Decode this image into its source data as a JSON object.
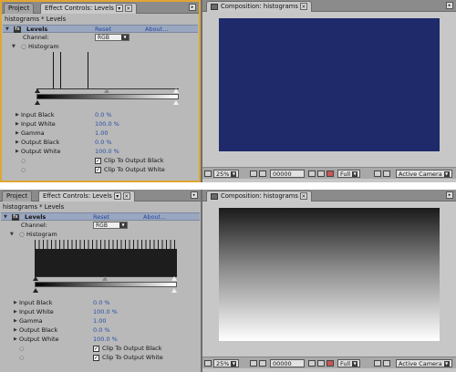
{
  "screens": [
    {
      "tabs": {
        "project": "Project",
        "effect_controls": "Effect Controls: Levels",
        "composition": "Composition: histograms"
      },
      "breadcrumb": "histograms * Levels",
      "effect": {
        "name": "Levels",
        "reset": "Reset",
        "about": "About...",
        "channel_label": "Channel:",
        "channel_value": "RGB",
        "histogram_label": "Histogram"
      },
      "properties": [
        {
          "label": "Input Black",
          "value": "0.0 %"
        },
        {
          "label": "Input White",
          "value": "100.0 %"
        },
        {
          "label": "Gamma",
          "value": "1.00"
        },
        {
          "label": "Output Black",
          "value": "0.0 %"
        },
        {
          "label": "Output White",
          "value": "100.0 %"
        }
      ],
      "checkboxes": [
        "Clip To Output Black",
        "Clip To Output White"
      ],
      "viewer_fill": "#1e2a6a",
      "toolbar": {
        "zoom": "25%",
        "timecode": "00000",
        "resolution": "Full",
        "camera": "Active Camera"
      }
    },
    {
      "tabs": {
        "project": "Project",
        "effect_controls": "Effect Controls: Levels",
        "composition": "Composition: histograms"
      },
      "breadcrumb": "histograms * Levels",
      "effect": {
        "name": "Levels",
        "reset": "Reset",
        "about": "About...",
        "channel_label": "Channel:",
        "channel_value": "RGB",
        "histogram_label": "Histogram"
      },
      "properties": [
        {
          "label": "Input Black",
          "value": "0.0 %"
        },
        {
          "label": "Input White",
          "value": "100.0 %"
        },
        {
          "label": "Gamma",
          "value": "1.00"
        },
        {
          "label": "Output Black",
          "value": "0.0 %"
        },
        {
          "label": "Output White",
          "value": "100.0 %"
        }
      ],
      "checkboxes": [
        "Clip To Output Black",
        "Clip To Output White"
      ],
      "viewer_fill": "gradient",
      "toolbar": {
        "zoom": "25%",
        "timecode": "00000",
        "resolution": "Full",
        "camera": "Active Camera"
      }
    }
  ],
  "colors": {
    "accent_border": "#e0a533",
    "link_blue": "#2b4ea8",
    "viewer_blue": "#1e2a6a"
  }
}
